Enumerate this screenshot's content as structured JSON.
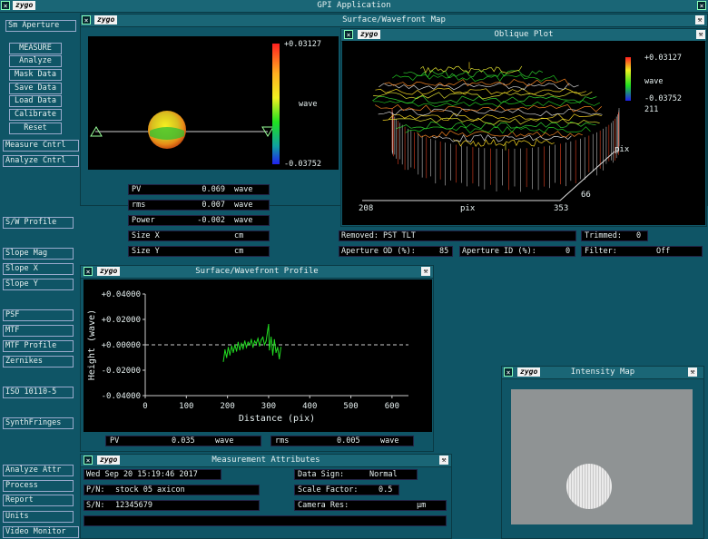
{
  "app": {
    "title": "GPI Application",
    "logo": "zygo"
  },
  "sidebar": {
    "aperture_label": "Sm Aperture",
    "top_buttons": [
      "MEASURE",
      "Analyze",
      "Mask Data",
      "Save Data",
      "Load Data",
      "Calibrate",
      "Reset"
    ],
    "items": [
      "Measure Cntrl",
      "Analyze Cntrl",
      "S/W Profile",
      "Slope Mag",
      "Slope X",
      "Slope Y",
      "PSF",
      "MTF",
      "MTF Profile",
      "Zernikes",
      "ISO 10110-5",
      "SynthFringes",
      "Analyze Attr",
      "Process",
      "Report",
      "Units",
      "Video Monitor"
    ]
  },
  "surface_map": {
    "title": "Surface/Wavefront Map",
    "colorbar_max": "+0.03127",
    "colorbar_unit": "wave",
    "colorbar_min": "-0.03752",
    "stats": [
      {
        "label": "PV",
        "value": "0.069",
        "unit": "wave"
      },
      {
        "label": "rms",
        "value": "0.007",
        "unit": "wave"
      },
      {
        "label": "Power",
        "value": "-0.002",
        "unit": "wave"
      },
      {
        "label": "Size X",
        "value": "",
        "unit": "cm"
      },
      {
        "label": "Size Y",
        "value": "",
        "unit": "cm"
      }
    ]
  },
  "oblique_plot": {
    "title": "Oblique Plot",
    "colorbar_max": "+0.03127",
    "colorbar_unit": "wave",
    "colorbar_min": "-0.03752",
    "y_max": "211",
    "y_label": "pix",
    "y_min": "66",
    "x_min": "208",
    "x_label": "pix",
    "x_max": "353",
    "removed": "Removed: PST TLT",
    "trimmed_label": "Trimmed:",
    "trimmed_value": "0",
    "aperture_od_label": "Aperture OD (%):",
    "aperture_od_value": "85",
    "aperture_id_label": "Aperture ID (%):",
    "aperture_id_value": "0",
    "filter_label": "Filter:",
    "filter_value": "Off"
  },
  "profile": {
    "title": "Surface/Wavefront Profile",
    "pv_label": "PV",
    "pv_value": "0.035",
    "pv_unit": "wave",
    "rms_label": "rms",
    "rms_value": "0.005",
    "rms_unit": "wave"
  },
  "chart_data": {
    "type": "line",
    "xlabel": "Distance (pix)",
    "ylabel": "Height (wave)",
    "xlim": [
      0,
      640
    ],
    "ylim": [
      -0.04,
      0.04
    ],
    "x_ticks": [
      "0",
      "100",
      "200",
      "300",
      "400",
      "500",
      "600"
    ],
    "y_ticks": [
      "+0.04000",
      "+0.02000",
      "+0.00000",
      "-0.02000",
      "-0.04000"
    ],
    "zero_line_dashed": true,
    "series": [
      {
        "color": "#22dd22",
        "x": [
          190,
          194,
          198,
          202,
          206,
          210,
          214,
          218,
          222,
          226,
          230,
          234,
          238,
          242,
          246,
          250,
          254,
          258,
          262,
          266,
          270,
          274,
          278,
          282,
          286,
          290,
          294,
          298,
          300,
          302,
          306,
          310,
          314,
          318,
          322,
          326,
          330
        ],
        "y": [
          -0.013,
          -0.004,
          -0.01,
          -0.002,
          -0.008,
          -0.001,
          -0.006,
          0.0,
          -0.005,
          0.002,
          -0.004,
          0.001,
          -0.003,
          0.003,
          -0.002,
          0.002,
          0.0,
          0.004,
          -0.002,
          0.003,
          0.001,
          0.005,
          -0.001,
          0.004,
          0.006,
          0.0,
          0.003,
          0.012,
          0.016,
          -0.004,
          0.006,
          -0.008,
          0.004,
          -0.006,
          -0.002,
          -0.011,
          -0.002
        ]
      }
    ]
  },
  "measurement_attributes": {
    "title": "Measurement Attributes",
    "date": "Wed Sep 20 15:19:46 2017",
    "pn_label": "P/N:",
    "pn_value": "stock 05 axicon",
    "sn_label": "S/N:",
    "sn_value": "12345679",
    "data_sign_label": "Data Sign:",
    "data_sign_value": "Normal",
    "scale_factor_label": "Scale Factor:",
    "scale_factor_value": "0.5",
    "camera_res_label": "Camera Res:",
    "camera_res_unit": "µm"
  },
  "intensity_map": {
    "title": "Intensity Map"
  },
  "colors": {
    "background": "#0f5566",
    "title_bar": "#1a6676",
    "plot_line": "#22dd22"
  }
}
